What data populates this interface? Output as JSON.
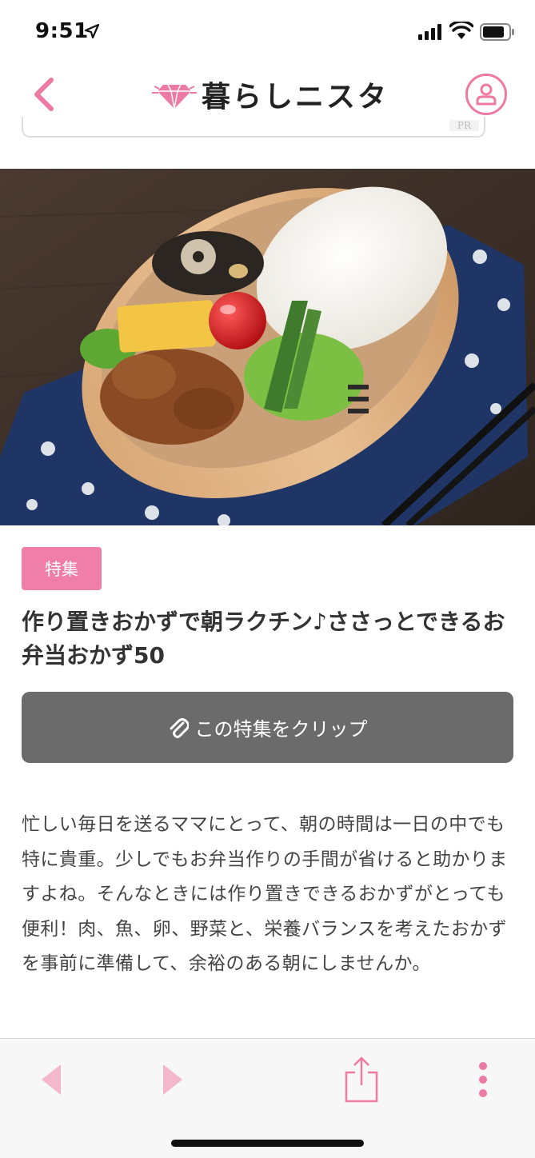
{
  "status_bar": {
    "time": "9:51"
  },
  "header": {
    "logo_text": "暮らしニスタ"
  },
  "ad": {
    "label": "PR"
  },
  "article": {
    "tag": "特集",
    "title": "作り置きおかずで朝ラクチン♪ささっとできるお弁当おかず50",
    "clip_label": "この特集をクリップ",
    "body": "忙しい毎日を送るママにとって、朝の時間は一日の中でも特に貴重。少しでもお弁当作りの手間が省けると助かりますよね。そんなときには作り置きできるおかずがとっても便利！肉、魚、卵、野菜と、栄養バランスを考えたおかずを事前に準備して、余裕のある朝にしませんか。"
  },
  "colors": {
    "accent": "#ef7fa7",
    "button": "#6b6b6b"
  },
  "icons": [
    "location-arrow-icon",
    "signal-icon",
    "wifi-icon",
    "battery-icon",
    "back-chevron-icon",
    "diamond-logo-icon",
    "user-icon",
    "paperclip-icon",
    "share-icon",
    "more-icon"
  ]
}
